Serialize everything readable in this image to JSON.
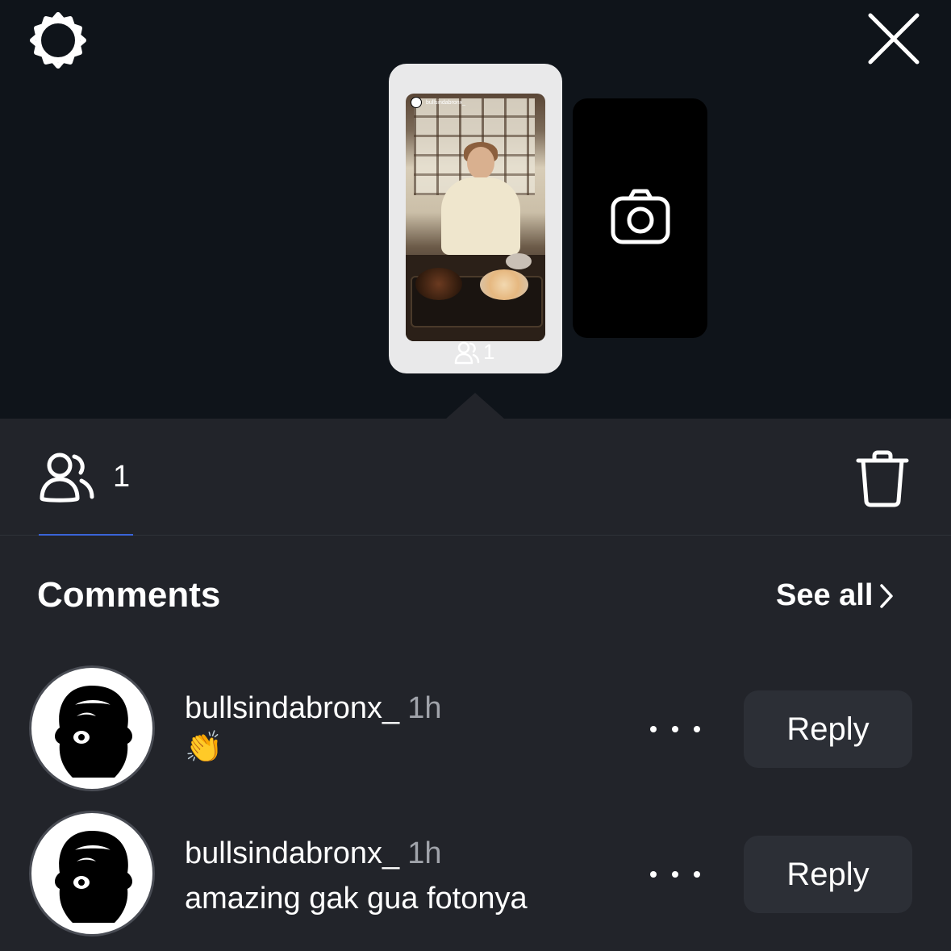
{
  "header": {
    "settings_icon": "gear-icon",
    "close_icon": "close-icon"
  },
  "story": {
    "username": "bullsindabronx_",
    "viewer_count": "1",
    "camera_icon": "camera-icon"
  },
  "viewers_tab": {
    "icon": "people-icon",
    "count": "1",
    "delete_icon": "trash-icon"
  },
  "comments": {
    "title": "Comments",
    "see_all_label": "See all",
    "items": [
      {
        "username": "bullsindabronx_",
        "time": "1h",
        "text": "👏",
        "reply_label": "Reply"
      },
      {
        "username": "bullsindabronx_",
        "time": "1h",
        "text": "amazing gak gua fotonya",
        "reply_label": "Reply"
      }
    ]
  },
  "colors": {
    "top_background": "#0f141a",
    "sheet_background": "#22242a",
    "reply_button": "#2c2f36",
    "tab_underline": "#3a64d8",
    "muted_text": "#a0a3aa"
  }
}
